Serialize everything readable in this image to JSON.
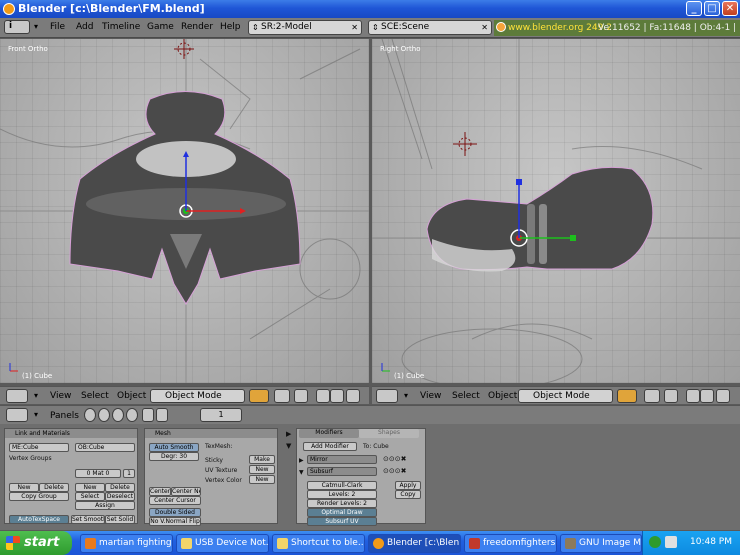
{
  "window": {
    "title": "Blender [c:\\Blender\\FM.blend]",
    "min": "_",
    "max": "□",
    "close": "✕"
  },
  "menu": {
    "items": [
      "File",
      "Add",
      "Timeline",
      "Game",
      "Render",
      "Help"
    ],
    "screen": "SR:2-Model",
    "scene": "SCE:Scene",
    "url": "www.blender.org 249.2",
    "stats": "Ve:11652 | Fa:11648 | Ob:4-1 | L"
  },
  "viewport_left": {
    "label": "Front Ortho",
    "object": "(1) Cube"
  },
  "viewport_right": {
    "label": "Right Ortho",
    "object": "(1) Cube"
  },
  "viewport_header": {
    "view": "View",
    "select": "Select",
    "object": "Object",
    "mode": "Object Mode"
  },
  "buttons_header": {
    "panels": "Panels",
    "frame": "1"
  },
  "link_panel": {
    "title": "Link and Materials",
    "me": "ME:Cube",
    "ob": "OB:Cube",
    "vertex_groups": "Vertex Groups",
    "mat": "0 Mat 0",
    "mat_count": "1",
    "new": "New",
    "delete": "Delete",
    "copy_group": "Copy Group",
    "new2": "New",
    "delete2": "Delete",
    "select": "Select",
    "deselect": "Deselect",
    "assign": "Assign",
    "autotexspace": "AutoTexSpace",
    "set_smooth": "Set Smooth",
    "set_solid": "Set Solid"
  },
  "mesh_panel": {
    "title": "Mesh",
    "auto_smooth": "Auto Smooth",
    "degr": "Degr: 30",
    "texmesh": "TexMesh:",
    "sticky": "Sticky",
    "make": "Make",
    "uv_texture": "UV Texture",
    "new": "New",
    "vertex_color": "Vertex Color",
    "new2": "New",
    "center": "Center",
    "center_new": "Center New",
    "center_cursor": "Center Cursor",
    "double_sided": "Double Sided",
    "no_vnormal_flip": "No V.Normal Flip"
  },
  "modifiers_panel": {
    "tab_modifiers": "Modifiers",
    "tab_shapes": "Shapes",
    "add_modifier": "Add Modifier",
    "to": "To: Cube",
    "mod1": "Mirror",
    "mod2": "Subsurf",
    "subsurf_type": "Catmull-Clark",
    "levels": "Levels: 2",
    "render_levels": "Render Levels: 2",
    "optimal_draw": "Optimal Draw",
    "subsurf_uv": "Subsurf UV",
    "apply": "Apply",
    "copy": "Copy"
  },
  "taskbar": {
    "start": "start",
    "tasks": [
      "martian fighting...",
      "USB Device Not...",
      "Shortcut to ble...",
      "Blender [c:\\Blen...",
      "freedomfighters...",
      "GNU Image Man..."
    ],
    "clock": "10:48 PM"
  },
  "colors": {
    "accent": "#f29a17",
    "xp_blue": "#2160e0",
    "stats_green": "#5d7b3a"
  }
}
